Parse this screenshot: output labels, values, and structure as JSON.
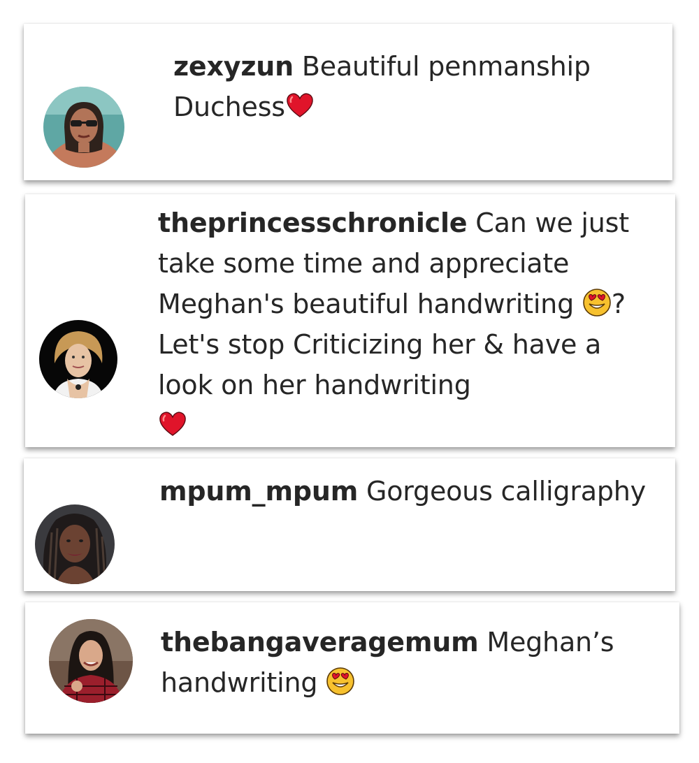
{
  "comments": [
    {
      "username": "zexyzun",
      "text_before": "Beautiful penmanship Duchess",
      "text_after": "",
      "emoji": "red-heart",
      "avatar": "woman-sunglasses-avatar"
    },
    {
      "username": "theprincesschronicle",
      "text_before": "Can we just take some time and appreciate Meghan's beautiful handwriting",
      "text_after": "? Let's stop Criticizing her & have a look on her handwriting",
      "emoji": "heart-eyes-face",
      "emoji2": "red-heart",
      "avatar": "princess-portrait-avatar"
    },
    {
      "username": "mpum_mpum",
      "text_before": "Gorgeous calligraphy",
      "text_after": "",
      "avatar": "woman-braids-avatar"
    },
    {
      "username": "thebangaveragemum",
      "text_before": "Meghan’s handwriting",
      "text_after": "",
      "emoji": "heart-eyes-face",
      "avatar": "woman-dark-hair-avatar"
    }
  ],
  "colors": {
    "text": "#262626",
    "heart": "#e0142a",
    "emoji_face": "#f7c12e"
  }
}
